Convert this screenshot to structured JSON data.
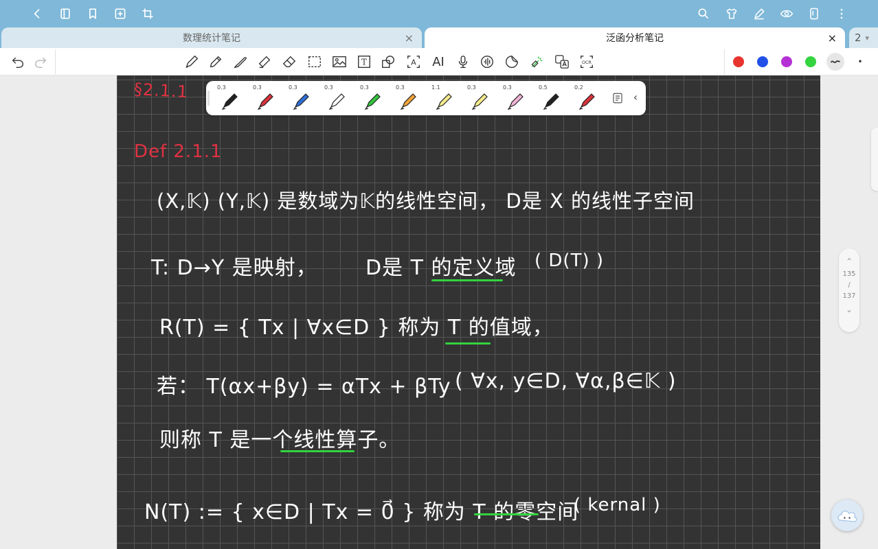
{
  "topbar": {
    "icons": [
      "back-icon",
      "book-icon",
      "bookmark-icon",
      "add-page-icon",
      "crop-icon",
      "search-icon",
      "shirt-icon",
      "pen-settings-icon",
      "eye-icon",
      "tablet-icon",
      "more-icon"
    ]
  },
  "tabs": [
    {
      "label": "数理统计笔记",
      "close": "×",
      "active": false
    },
    {
      "label": "泛函分析笔记",
      "close": "×",
      "active": true
    }
  ],
  "tab_count": {
    "value": "2",
    "arrow": "▾"
  },
  "toolbar": {
    "tools": [
      "undo-icon",
      "redo-icon",
      "pen-icon",
      "pencil-icon",
      "brush-icon",
      "highlighter-icon",
      "eraser-icon",
      "lasso-select-icon",
      "image-icon",
      "text-box-icon",
      "shape-icon",
      "text-recognize-icon",
      "ai-icon",
      "microphone-icon",
      "audio-icon",
      "sticker-icon",
      "laser-pointer-icon",
      "translate-icon",
      "ocr-icon"
    ],
    "ai_label": "AI",
    "ocr_label": "OCR",
    "text_label": "T",
    "recognize_label": "A",
    "colors": [
      "#e8342e",
      "#2050e8",
      "#b531d6",
      "#33d43f"
    ],
    "more": "•"
  },
  "pen_presets": [
    {
      "size": "0.3",
      "color": "#222222"
    },
    {
      "size": "0.3",
      "color": "#d8323c"
    },
    {
      "size": "0.3",
      "color": "#2f6fd6"
    },
    {
      "size": "0.3",
      "color": "#ffffff"
    },
    {
      "size": "0.3",
      "color": "#33c43f"
    },
    {
      "size": "0.3",
      "color": "#f2a33a"
    },
    {
      "size": "1.1",
      "color": "#f4ec8c"
    },
    {
      "size": "0.3",
      "color": "#f4ec8c"
    },
    {
      "size": "0.3",
      "color": "#f0b3d6"
    },
    {
      "size": "0.5",
      "color": "#222222"
    },
    {
      "size": "0.2",
      "color": "#d8323c"
    }
  ],
  "note": {
    "section": "§2.1.1",
    "def_label": "Def 2.1.1",
    "line1": "(X,𝕂)   (Y,𝕂) 是数域为𝕂的线性空间，   D是 X 的线性子空间",
    "line2a": "T: D→Y 是映射，",
    "line2b": "D是 T 的定义域",
    "line2c": "( D(T) )",
    "line3a": "R(T) = { Tx | ∀x∈D }  称为 T 的值域，",
    "line4a": "若：  T(αx+βy) = αTx + βTy",
    "line4b": "( ∀x, y∈D,    ∀α,β∈𝕂 )",
    "line5": "则称 T 是一个线性算子。",
    "line6a": "N(T) := { x∈D | Tx = 0⃗ }  称为 T 的零空间",
    "line6b": "( kernal )"
  },
  "pager": {
    "up": "⌃",
    "current": "135",
    "sep": "/",
    "total": "137",
    "down": "⌄"
  }
}
